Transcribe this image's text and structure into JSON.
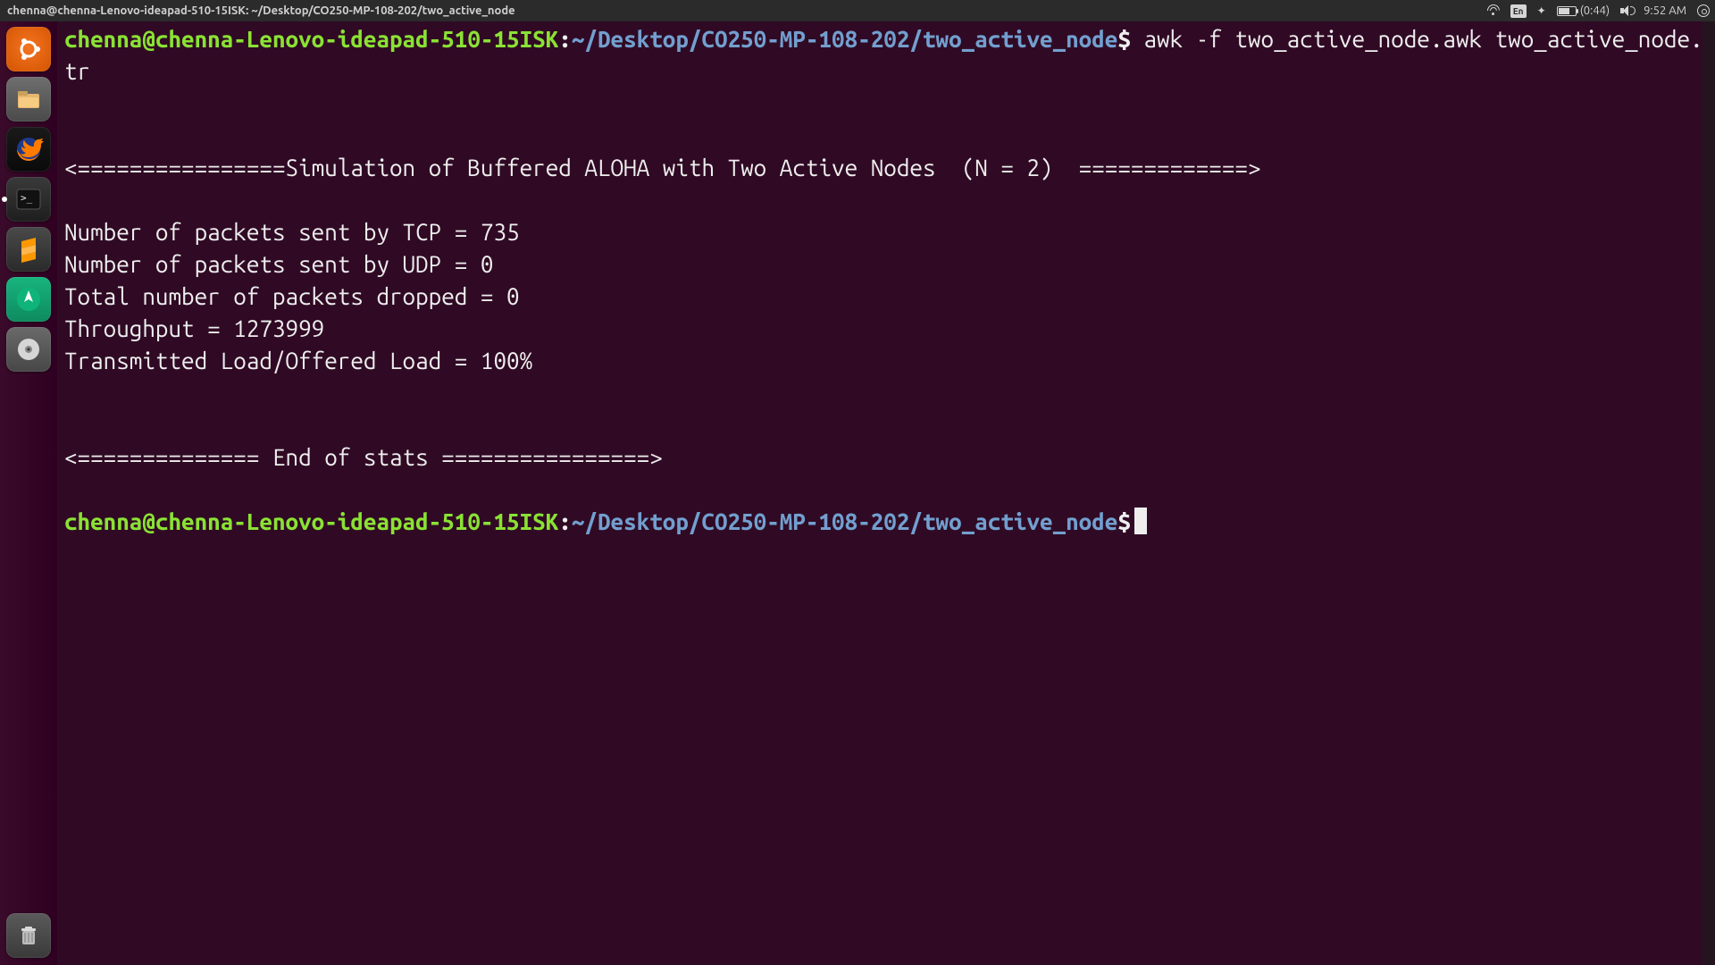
{
  "menubar": {
    "title": "chenna@chenna-Lenovo-ideapad-510-15ISK: ~/Desktop/CO250-MP-108-202/two_active_node",
    "lang": "En",
    "battery_time": "(0:44)",
    "clock": "9:52 AM"
  },
  "launcher": {
    "items": [
      {
        "name": "dash-icon"
      },
      {
        "name": "files-icon"
      },
      {
        "name": "firefox-icon"
      },
      {
        "name": "terminal-icon"
      },
      {
        "name": "sublime-icon"
      },
      {
        "name": "navigation-icon"
      },
      {
        "name": "disc-icon"
      }
    ],
    "trash": "trash-icon"
  },
  "terminal": {
    "prompt1": {
      "user": "chenna@chenna-Lenovo-ideapad-510-15ISK",
      "sep": ":",
      "path": "~/Desktop/CO250-MP-108-202/two_active_node",
      "dollar": "$",
      "command": " awk -f two_active_node.awk two_active_node.tr"
    },
    "output": {
      "blank1": "",
      "blank2": "",
      "header": "<================Simulation of Buffered ALOHA with Two Active Nodes  (N = 2)  =============>",
      "blank3": "",
      "l1": "Number of packets sent by TCP = 735",
      "l2": "Number of packets sent by UDP = 0",
      "l3": "Total number of packets dropped = 0",
      "l4": "Throughput = 1273999",
      "l5": "Transmitted Load/Offered Load = 100%",
      "blank4": "",
      "blank5": "",
      "footer": "<============== End of stats ================>",
      "blank6": ""
    },
    "prompt2": {
      "user": "chenna@chenna-Lenovo-ideapad-510-15ISK",
      "sep": ":",
      "path": "~/Desktop/CO250-MP-108-202/two_active_node",
      "dollar": "$"
    }
  }
}
